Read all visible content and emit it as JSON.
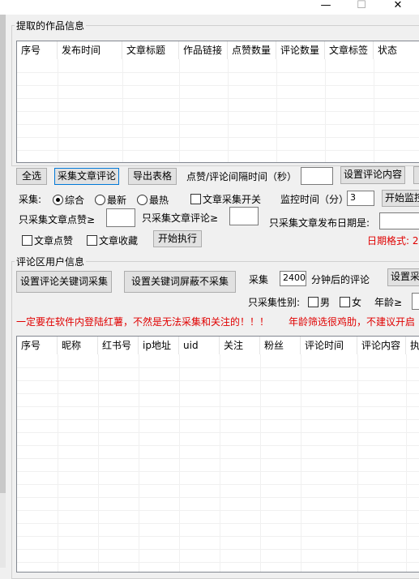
{
  "window": {
    "minimize": "—",
    "maximize": "☐",
    "close": "✕"
  },
  "works_group": {
    "title": "提取的作品信息",
    "columns": [
      "序号",
      "发布时间",
      "文章标题",
      "作品链接",
      "点赞数量",
      "评论数量",
      "文章标签",
      "状态"
    ]
  },
  "toolbar1": {
    "select_all": "全选",
    "collect_comments": "采集文章评论",
    "export_table": "导出表格",
    "interval_label": "点赞/评论间隔时间（秒）",
    "interval_value": "",
    "set_comment_content": "设置评论内容"
  },
  "collect_row": {
    "label": "采集:",
    "opt_all": "综合",
    "opt_newest": "最新",
    "opt_hottest": "最热",
    "article_switch": "文章采集开关",
    "monitor_label": "监控时间（分）",
    "monitor_value": "3",
    "start_monitor": "开始监控"
  },
  "filter_row": {
    "min_likes_label": "只采集文章点赞≥",
    "min_likes_value": "",
    "min_comments_label": "只采集文章评论≥",
    "min_comments_value": "",
    "date_label": "只采集文章发布日期是:",
    "date_value": ""
  },
  "action_row": {
    "like_article": "文章点赞",
    "fav_article": "文章收藏",
    "execute": "开始执行",
    "date_format_hint": "日期格式: 2"
  },
  "users_group": {
    "title": "评论区用户信息",
    "set_keyword_collect": "设置评论关键词采集",
    "set_keyword_block": "设置关键词屏蔽不采集",
    "collect_label": "采集",
    "minutes_value": "2400",
    "minutes_suffix": "分钟后的评论",
    "set_collect": "设置采",
    "gender_label": "只采集性别:",
    "male": "男",
    "female": "女",
    "age_label": "年龄≥"
  },
  "warnings": {
    "login": "一定要在软件内登陆红薯，不然是无法采集和关注的！！！",
    "age": "年龄筛选很鸡肋，不建议开启"
  },
  "users_grid": {
    "columns": [
      "序号",
      "昵称",
      "红书号",
      "ip地址",
      "uid",
      "关注",
      "粉丝",
      "评论时间",
      "评论内容",
      "执"
    ]
  }
}
